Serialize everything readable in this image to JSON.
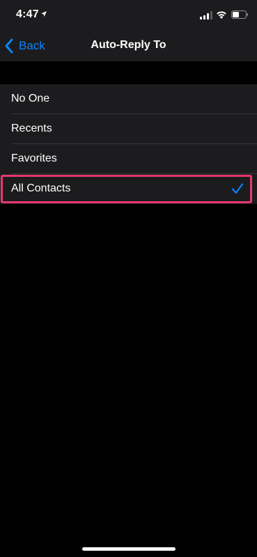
{
  "status_bar": {
    "time": "4:47"
  },
  "nav": {
    "back_label": "Back",
    "title": "Auto-Reply To"
  },
  "options": [
    {
      "label": "No One",
      "selected": false
    },
    {
      "label": "Recents",
      "selected": false
    },
    {
      "label": "Favorites",
      "selected": false
    },
    {
      "label": "All Contacts",
      "selected": true
    }
  ],
  "icons": {
    "location": "location-arrow-icon",
    "signal": "cellular-signal-icon",
    "wifi": "wifi-icon",
    "battery": "battery-icon",
    "back": "chevron-left-icon",
    "check": "checkmark-icon"
  },
  "colors": {
    "accent": "#0a84ff",
    "highlight": "#e8386d",
    "cell_background": "#1c1c1e",
    "background": "#000000"
  }
}
